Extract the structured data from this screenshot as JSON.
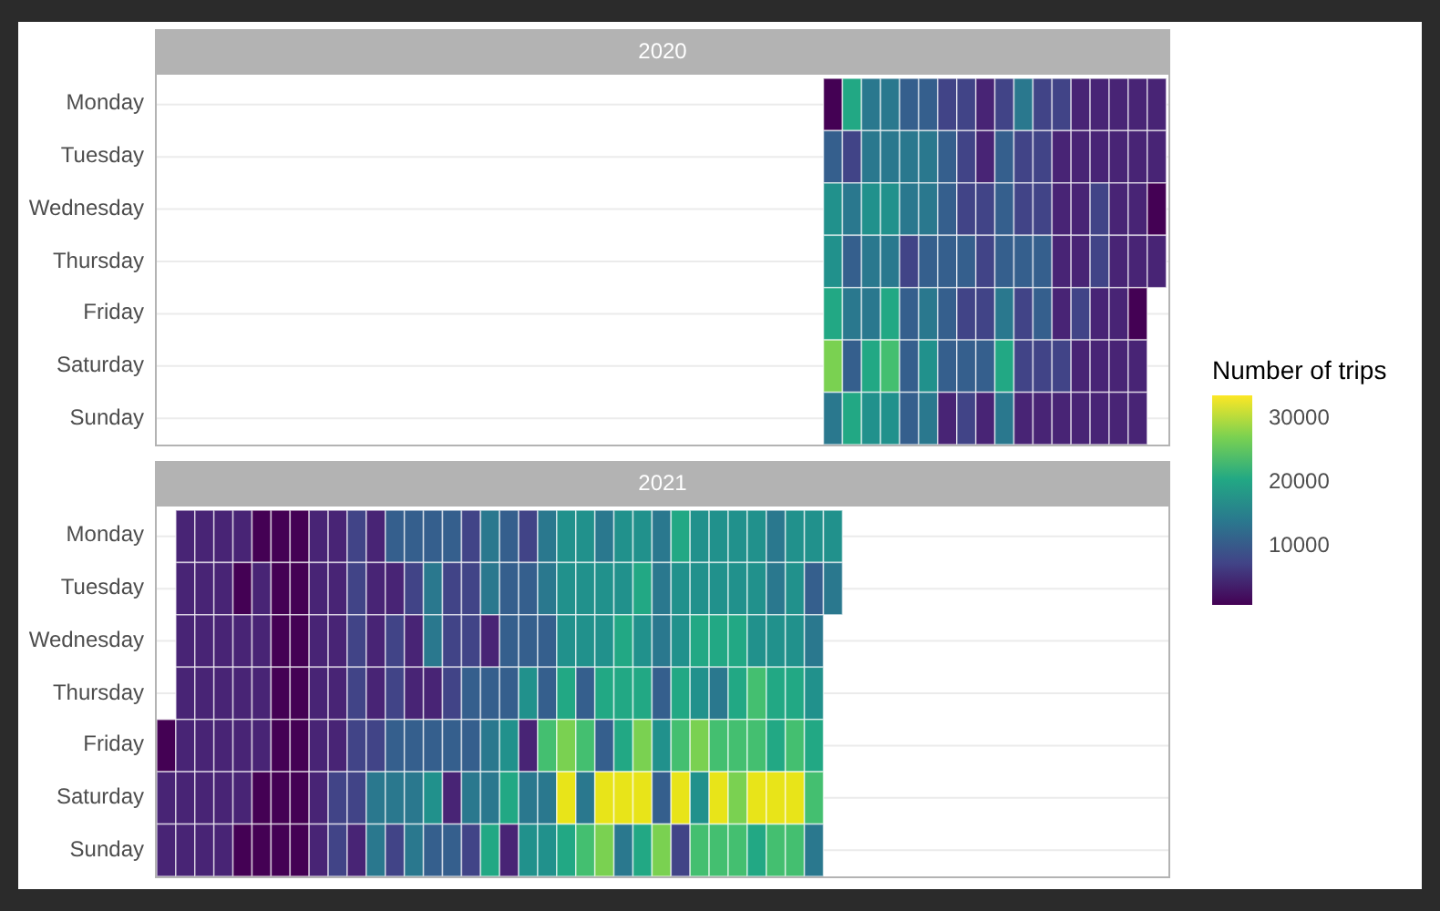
{
  "facets": [
    {
      "title": "2020",
      "days": [
        "Monday",
        "Tuesday",
        "Wednesday",
        "Thursday",
        "Friday",
        "Saturday",
        "Sunday"
      ]
    },
    {
      "title": "2021",
      "days": [
        "Monday",
        "Tuesday",
        "Wednesday",
        "Thursday",
        "Friday",
        "Saturday",
        "Sunday"
      ]
    }
  ],
  "legend": {
    "title": "Number of trips",
    "ticks": [
      "30000",
      "20000",
      "10000"
    ]
  }
}
